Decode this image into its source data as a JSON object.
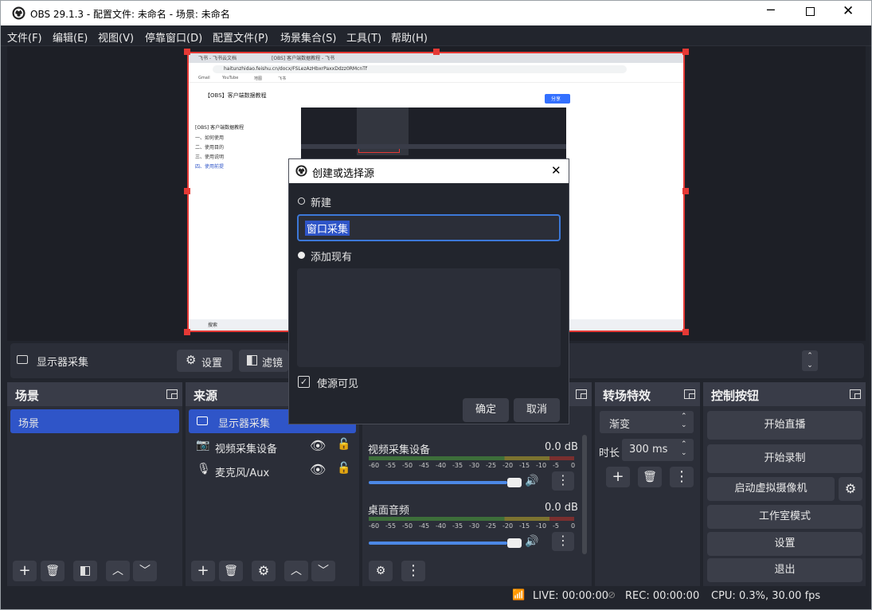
{
  "window": {
    "title": "OBS 29.1.3 - 配置文件: 未命名 - 场景: 未命名"
  },
  "menu": [
    "文件(F)",
    "编辑(E)",
    "视图(V)",
    "停靠窗口(D)",
    "配置文件(P)",
    "场景集合(S)",
    "工具(T)",
    "帮助(H)"
  ],
  "source_bar": {
    "selected_source": "显示器采集",
    "settings": "设置",
    "filters": "滤镜"
  },
  "scenes": {
    "title": "场景",
    "items": [
      "场景"
    ]
  },
  "sources": {
    "title": "来源",
    "items": [
      "显示器采集",
      "视频采集设备",
      "麦克风/Aux"
    ]
  },
  "mixer": {
    "channels": [
      {
        "name": "视频采集设备",
        "db": "0.0 dB",
        "level": 0.92
      },
      {
        "name": "桌面音频",
        "db": "0.0 dB",
        "level": 0.92
      }
    ],
    "scale": [
      "-60",
      "-55",
      "-50",
      "-45",
      "-40",
      "-35",
      "-30",
      "-25",
      "-20",
      "-15",
      "-10",
      "-5",
      "0"
    ]
  },
  "transitions": {
    "title": "转场特效",
    "type": "渐变",
    "duration_label": "时长",
    "duration": "300 ms"
  },
  "controls": {
    "title": "控制按钮",
    "start_stream": "开始直播",
    "start_record": "开始录制",
    "virtual_cam": "启动虚拟摄像机",
    "studio_mode": "工作室模式",
    "settings": "设置",
    "exit": "退出"
  },
  "status": {
    "live": "LIVE: 00:00:00",
    "rec": "REC: 00:00:00",
    "cpu": "CPU: 0.3%, 30.00 fps"
  },
  "dialog": {
    "title": "创建或选择源",
    "new_label": "新建",
    "name_value": "窗口采集",
    "add_existing": "添加现有",
    "make_visible": "使源可见",
    "ok": "确定",
    "cancel": "取消"
  },
  "preview_capture": {
    "tabs": [
      "飞书 - 飞书云文档",
      "[OBS] 客户端数据教程 - 飞书"
    ],
    "url": "haitunzhidao.feishu.cn/docx/FSLezAzHbxrPaxxDdzz0RMcnTf",
    "bookmarks": [
      "Gmail",
      "YouTube",
      "地图",
      "飞书"
    ],
    "doc_title": "【OBS】客户端数据教程",
    "doc_subtitle": "[OBS] 客户端数据教程",
    "outline": [
      "一、如何使用",
      "二、使用目的",
      "三、使用说明",
      "四、使用前提"
    ],
    "share_button": "分享",
    "taskbar_search": "搜索"
  },
  "colors": {
    "accent": "#2f55c8",
    "selection_border": "#e53935",
    "bg": "#22252d"
  }
}
